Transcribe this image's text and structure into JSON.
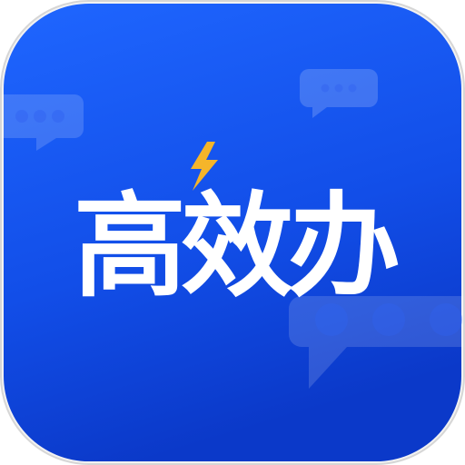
{
  "app_icon": {
    "logo_text": "高效办",
    "colors": {
      "gradient_top": "#1b5dff",
      "gradient_bottom": "#0c3fd6",
      "border": "#d9d9d9",
      "logo_text": "#ffffff",
      "accent": "#f5b52a",
      "bubble": "#ffffff"
    },
    "decorations": [
      "chat-bubble-icon",
      "chat-bubble-icon",
      "chat-bubble-icon",
      "lightning-bolt-icon"
    ]
  }
}
